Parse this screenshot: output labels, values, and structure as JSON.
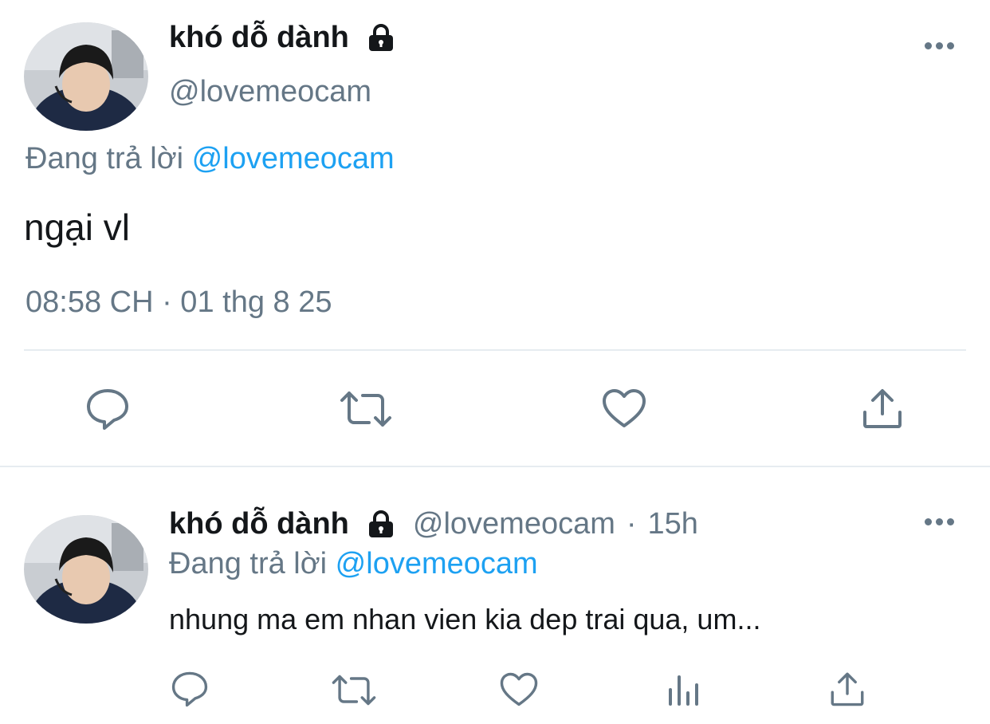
{
  "main_tweet": {
    "display_name": "khó dỗ dành",
    "handle": "@lovemeocam",
    "replying_prefix": "Đang trả lời",
    "replying_to": "@lovemeocam",
    "text": "ngại vl",
    "timestamp": "08:58 CH · 01 thg 8 25",
    "actions": [
      "reply-icon",
      "retweet-icon",
      "like-icon",
      "share-icon"
    ]
  },
  "reply_tweet": {
    "display_name": "khó dỗ dành",
    "handle": "@lovemeocam",
    "separator": "·",
    "time_ago": "15h",
    "replying_prefix": "Đang trả lời",
    "replying_to": "@lovemeocam",
    "text": "nhung ma em nhan vien kia dep trai qua, um...",
    "actions": [
      "reply-icon",
      "retweet-icon",
      "like-icon",
      "analytics-icon",
      "share-icon"
    ]
  },
  "colors": {
    "text": "#14171a",
    "secondary": "#657786",
    "link": "#1da1f2",
    "divider": "#e6ecf0"
  }
}
